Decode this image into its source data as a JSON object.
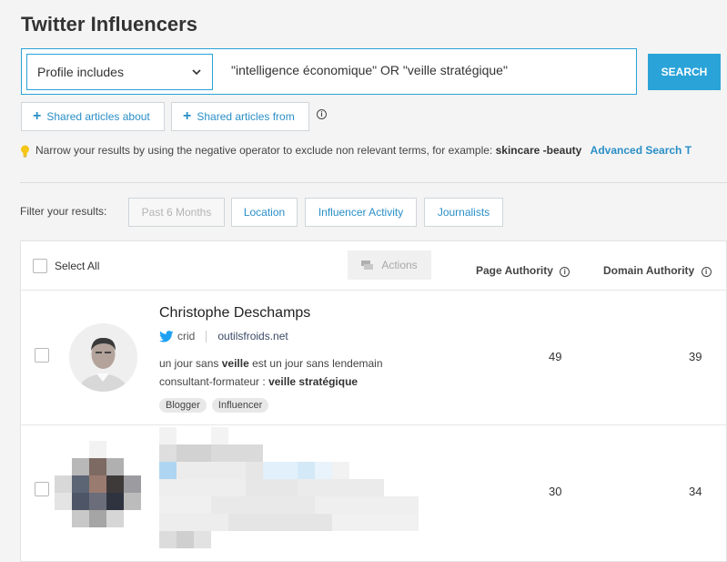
{
  "page": {
    "title": "Twitter Influencers"
  },
  "search": {
    "mode_label": "Profile includes",
    "query": "\"intelligence économique\" OR \"veille stratégique\"",
    "button_label": "SEARCH"
  },
  "shared_buttons": {
    "about_label": "Shared articles about",
    "from_label": "Shared articles from"
  },
  "hint": {
    "text": "Narrow your results by using the negative operator to exclude non relevant terms, for example:",
    "example": "skincare -beauty",
    "link_label": "Advanced Search T"
  },
  "filters": {
    "label": "Filter your results:",
    "buttons": [
      "Past 6 Months",
      "Location",
      "Influencer Activity",
      "Journalists"
    ]
  },
  "table": {
    "select_all_label": "Select All",
    "actions_label": "Actions",
    "columns": [
      "Page Authority",
      "Domain Authority"
    ],
    "rows": [
      {
        "name": "Christophe Deschamps",
        "handle": "crid",
        "website": "outilsfroids.net",
        "bio_line1_pre": "un jour sans ",
        "bio_line1_bold": "veille",
        "bio_line1_post": " est un jour sans lendemain",
        "bio_line2_pre": "consultant-formateur : ",
        "bio_line2_bold": "veille stratégique",
        "tags": [
          "Blogger",
          "Influencer"
        ],
        "page_authority": "49",
        "domain_authority": "39"
      },
      {
        "page_authority": "30",
        "domain_authority": "34"
      }
    ]
  },
  "icons": {
    "chevron": "chevron-down-icon",
    "info": "info-icon",
    "bulb": "lightbulb-icon",
    "twitter": "twitter-icon",
    "actions": "actions-icon"
  },
  "colors": {
    "accent": "#2aa3d8",
    "link": "#2a8fc7",
    "bulb": "#f5c518"
  }
}
